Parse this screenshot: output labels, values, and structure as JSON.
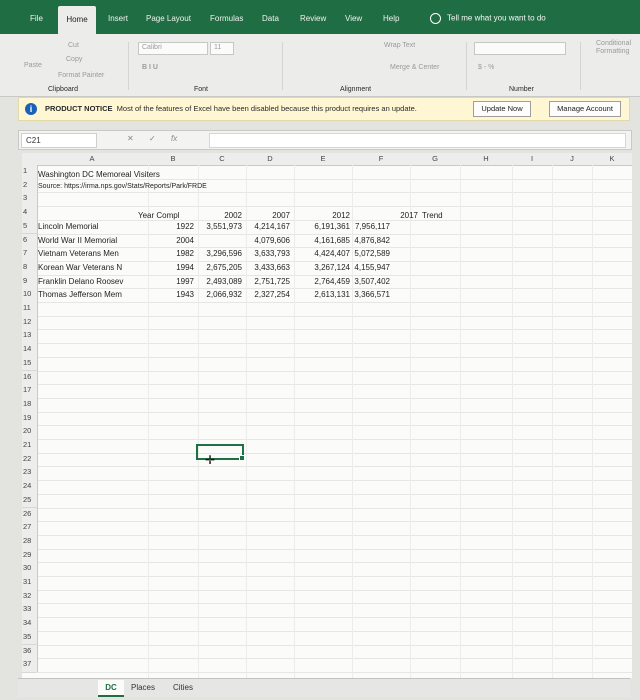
{
  "ribbon_tabs": [
    "File",
    "Home",
    "Insert",
    "Page Layout",
    "Formulas",
    "Data",
    "Review",
    "View",
    "Help"
  ],
  "tell_me": "Tell me what you want to do",
  "clipboard": {
    "cut": "Cut",
    "copy": "Copy",
    "paste": "Paste",
    "format_painter": "Format Painter"
  },
  "font": {
    "name": "Calibri",
    "size": "11"
  },
  "alignment": {
    "wrap_text": "Wrap Text",
    "merge_center": "Merge & Center"
  },
  "number": {
    "format_label": "$ - %"
  },
  "styles": {
    "conditional_formatting": "Conditional Formatting"
  },
  "group_labels": {
    "clipboard": "Clipboard",
    "font": "Font",
    "alignment": "Alignment",
    "number": "Number"
  },
  "notice": {
    "title": "PRODUCT NOTICE",
    "message": "Most of the features of Excel have been disabled because this product requires an update.",
    "update_button": "Update Now",
    "manage_button": "Manage Account"
  },
  "formula_bar": {
    "name_box": "C21",
    "cancel": "✕",
    "enter": "✓",
    "fx": "fx",
    "value": ""
  },
  "columns": [
    "A",
    "B",
    "C",
    "D",
    "E",
    "F",
    "G",
    "H",
    "I",
    "J",
    "K"
  ],
  "row_numbers": [
    "1",
    "2",
    "3",
    "4",
    "5",
    "6",
    "7",
    "8",
    "9",
    "10",
    "11",
    "12",
    "13",
    "14",
    "15",
    "16",
    "17",
    "18",
    "19",
    "20",
    "21",
    "22",
    "23",
    "24",
    "25",
    "26",
    "27",
    "28",
    "29",
    "30",
    "31",
    "32",
    "33",
    "34",
    "35",
    "36",
    "37"
  ],
  "sheet": {
    "title": "Washington DC Memoreal Visiters",
    "source": "Source: https://irma.nps.gov/Stats/Reports/Park/FRDE",
    "headers": {
      "year": "Year Compl",
      "y2002": "2002",
      "y2007": "2007",
      "y2012": "2012",
      "y2017": "2017",
      "trend": "Trend"
    },
    "rows": [
      {
        "name": "Lincoln Memorial",
        "year": "1922",
        "y2002": "3,551,973",
        "y2007": "4,214,167",
        "y2012": "6,191,361",
        "y2017": "7,956,117"
      },
      {
        "name": "World War II Memorial",
        "year": "2004",
        "y2002": "",
        "y2007": "4,079,606",
        "y2012": "4,161,685",
        "y2017": "4,876,842"
      },
      {
        "name": "Vietnam Veterans Men",
        "year": "1982",
        "y2002": "3,296,596",
        "y2007": "3,633,793",
        "y2012": "4,424,407",
        "y2017": "5,072,589"
      },
      {
        "name": "Korean War Veterans N",
        "year": "1994",
        "y2002": "2,675,205",
        "y2007": "3,433,663",
        "y2012": "3,267,124",
        "y2017": "4,155,947"
      },
      {
        "name": "Franklin Delano Roosev",
        "year": "1997",
        "y2002": "2,493,089",
        "y2007": "2,751,725",
        "y2012": "2,764,459",
        "y2017": "3,507,402"
      },
      {
        "name": "Thomas Jefferson Mem",
        "year": "1943",
        "y2002": "2,066,932",
        "y2007": "2,327,254",
        "y2012": "2,613,131",
        "y2017": "3,366,571"
      }
    ]
  },
  "sheet_tabs": [
    "DC",
    "Places",
    "Cities"
  ],
  "colors": {
    "accent": "#1f6e43",
    "notice_bg": "#fff6d4",
    "info": "#1a62b8"
  }
}
